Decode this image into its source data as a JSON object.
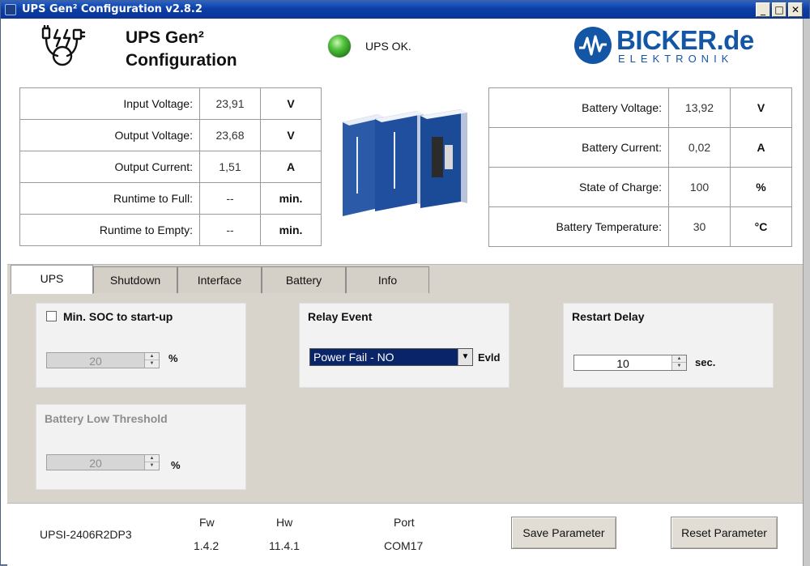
{
  "window": {
    "title": "UPS Gen² Configuration v2.8.2",
    "controls": [
      "_",
      "□",
      "✕"
    ]
  },
  "header": {
    "title_line1": "UPS Gen²",
    "title_line2": "Configuration",
    "status_text": "UPS OK.",
    "status_color": "#3cb62e",
    "brand_name": "BICKER.de",
    "brand_sub": "ELEKTRONIK",
    "brand_color": "#1456a6"
  },
  "left_table": [
    {
      "label": "Input Voltage:",
      "value": "23,91",
      "unit": "V"
    },
    {
      "label": "Output Voltage:",
      "value": "23,68",
      "unit": "V"
    },
    {
      "label": "Output Current:",
      "value": "1,51",
      "unit": "A"
    },
    {
      "label": "Runtime to Full:",
      "value": "--",
      "unit": "min."
    },
    {
      "label": "Runtime to Empty:",
      "value": "--",
      "unit": "min."
    }
  ],
  "right_table": [
    {
      "label": "Battery Voltage:",
      "value": "13,92",
      "unit": "V"
    },
    {
      "label": "Battery Current:",
      "value": "0,02",
      "unit": "A"
    },
    {
      "label": "State of Charge:",
      "value": "100",
      "unit": "%"
    },
    {
      "label": "Battery Temperature:",
      "value": "30",
      "unit": "°C"
    }
  ],
  "tabs": [
    {
      "label": "UPS",
      "active": true
    },
    {
      "label": "Shutdown",
      "active": false
    },
    {
      "label": "Interface",
      "active": false
    },
    {
      "label": "Battery",
      "active": false
    },
    {
      "label": "Info",
      "active": false
    }
  ],
  "ups_tab": {
    "min_soc": {
      "checkbox_label": "Min. SOC to start-up",
      "checked": false,
      "value": "20",
      "unit": "%"
    },
    "battery_low": {
      "title": "Battery Low Threshold",
      "value": "20",
      "unit": "%"
    },
    "relay": {
      "title": "Relay Event",
      "selected": "Power Fail - NO",
      "suffix": "Evld"
    },
    "restart": {
      "title": "Restart Delay",
      "value": "10",
      "unit": "sec."
    }
  },
  "footer": {
    "model": "UPSI-2406R2DP3",
    "fw_label": "Fw",
    "fw_value": "1.4.2",
    "hw_label": "Hw",
    "hw_value": "11.4.1",
    "port_label": "Port",
    "port_value": "COM17",
    "save_label": "Save Parameter",
    "reset_label": "Reset Parameter"
  }
}
